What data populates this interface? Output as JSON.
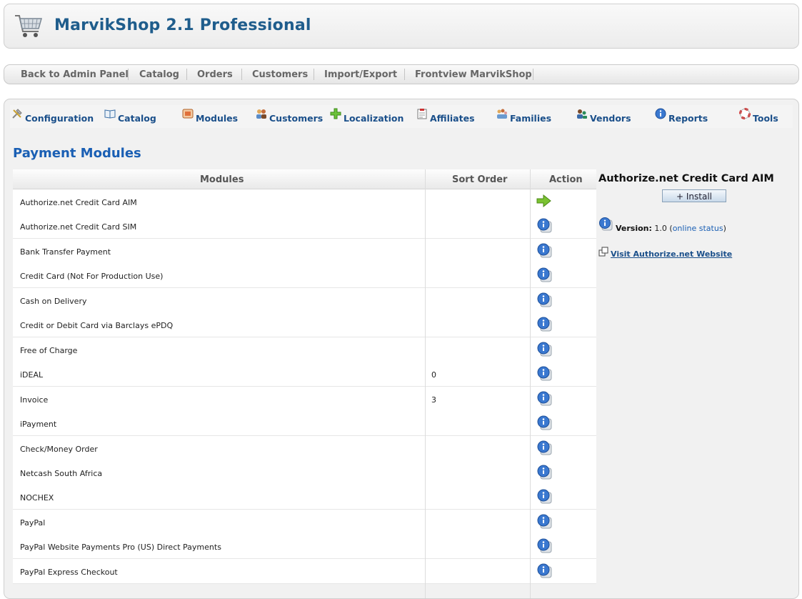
{
  "app": {
    "title": "MarvikShop 2.1 Professional"
  },
  "topnav": {
    "items": [
      "Back to Admin Panel",
      "Catalog",
      "Orders",
      "Customers",
      "Import/Export",
      "Frontview MarvikShop"
    ]
  },
  "tabs": {
    "items": [
      {
        "label": "Configuration",
        "icon": "tools-config-icon"
      },
      {
        "label": "Catalog",
        "icon": "book-icon"
      },
      {
        "label": "Modules",
        "icon": "modules-icon"
      },
      {
        "label": "Customers",
        "icon": "customers-icon"
      },
      {
        "label": "Localization",
        "icon": "plus-icon"
      },
      {
        "label": "Affiliates",
        "icon": "clipboard-icon"
      },
      {
        "label": "Families",
        "icon": "families-icon"
      },
      {
        "label": "Vendors",
        "icon": "vendors-icon"
      },
      {
        "label": "Reports",
        "icon": "info-icon"
      },
      {
        "label": "Tools",
        "icon": "lifebuoy-icon"
      }
    ]
  },
  "page": {
    "title": "Payment Modules"
  },
  "grid": {
    "headers": {
      "modules": "Modules",
      "sort_order": "Sort Order",
      "action": "Action"
    },
    "rows": [
      {
        "name": "Authorize.net Credit Card AIM",
        "sort": "",
        "action": "arrow"
      },
      {
        "name": "Authorize.net Credit Card SIM",
        "sort": "",
        "action": "info"
      },
      {
        "name": "Bank Transfer Payment",
        "sort": "",
        "action": "info"
      },
      {
        "name": "Credit Card (Not For Production Use)",
        "sort": "",
        "action": "info"
      },
      {
        "name": "Cash on Delivery",
        "sort": "",
        "action": "info"
      },
      {
        "name": "Credit or Debit Card via Barclays ePDQ",
        "sort": "",
        "action": "info"
      },
      {
        "name": "Free of Charge",
        "sort": "",
        "action": "info"
      },
      {
        "name": "iDEAL",
        "sort": "0",
        "action": "info"
      },
      {
        "name": "Invoice",
        "sort": "3",
        "action": "info"
      },
      {
        "name": "iPayment",
        "sort": "",
        "action": "info"
      },
      {
        "name": "Check/Money Order",
        "sort": "",
        "action": "info"
      },
      {
        "name": "Netcash South Africa",
        "sort": "",
        "action": "info"
      },
      {
        "name": "NOCHEX",
        "sort": "",
        "action": "info"
      },
      {
        "name": "PayPal",
        "sort": "",
        "action": "info"
      },
      {
        "name": "PayPal Website Payments Pro (US) Direct Payments",
        "sort": "",
        "action": "info"
      },
      {
        "name": "PayPal Express Checkout",
        "sort": "",
        "action": "info"
      }
    ]
  },
  "side": {
    "title": "Authorize.net Credit Card AIM",
    "install_label": "+ Install",
    "version_label": "Version:",
    "version_value": "1.0",
    "online_status": "online status",
    "visit_label": "Visit Authorize.net Website"
  }
}
